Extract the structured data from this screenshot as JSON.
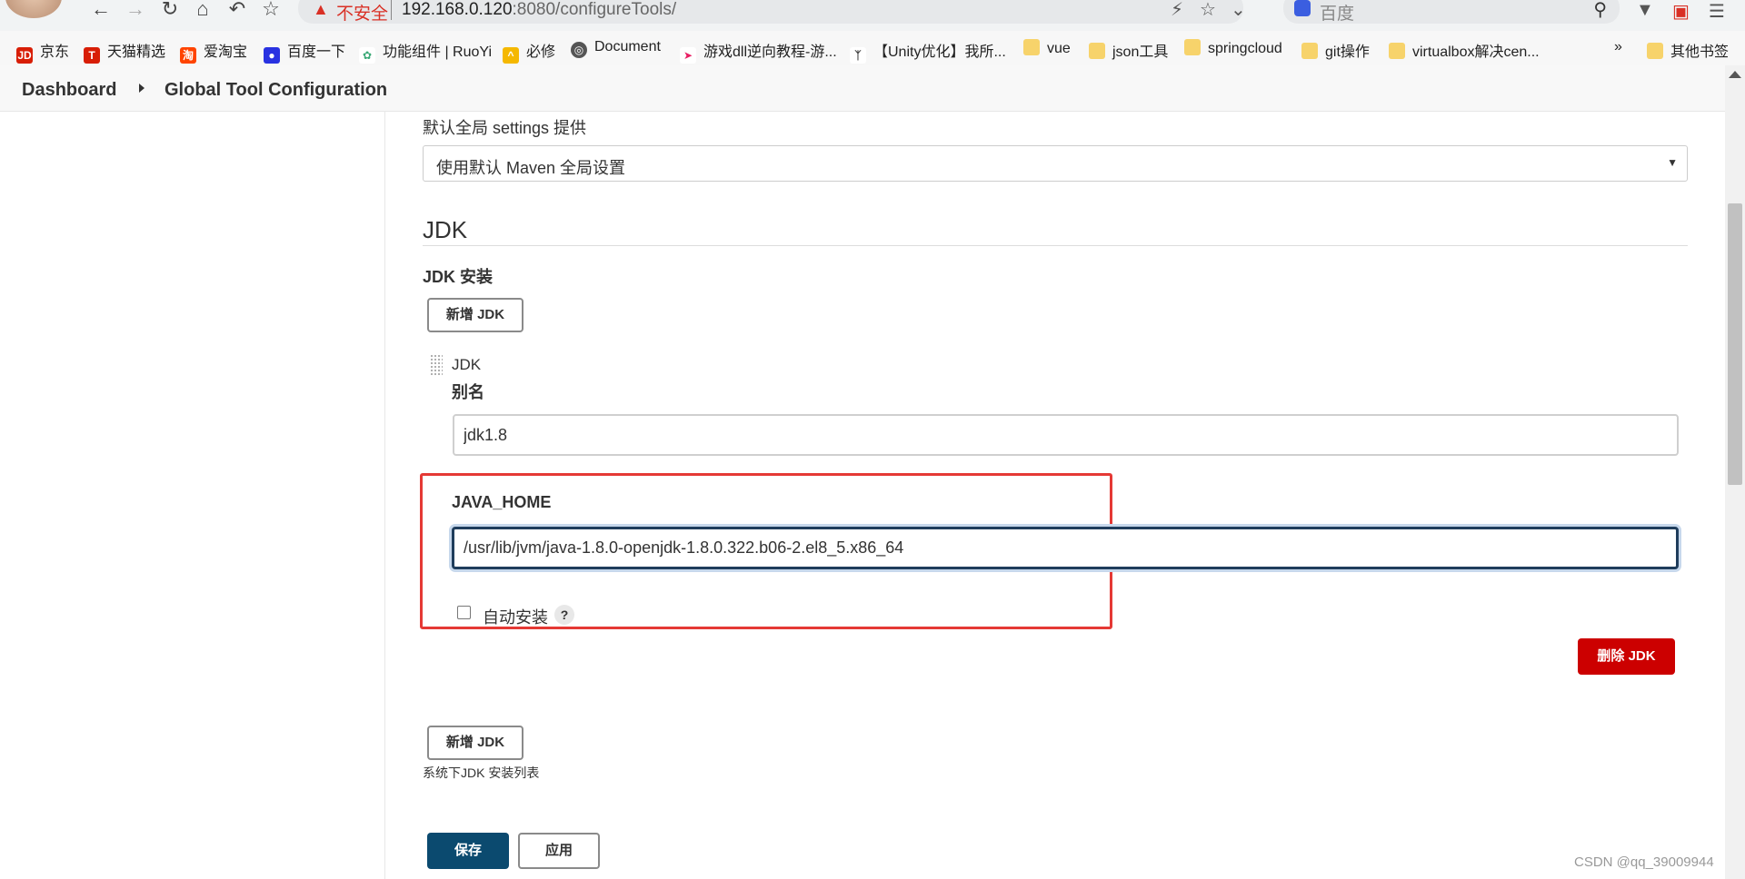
{
  "browser": {
    "security_warning": "不安全",
    "url_host": "192.168.0.120",
    "url_rest": ":8080/configureTools/",
    "search_placeholder": "百度"
  },
  "bookmarks": [
    {
      "label": "京东",
      "icon": "JD"
    },
    {
      "label": "天猫精选",
      "icon": "T"
    },
    {
      "label": "爱淘宝",
      "icon": "淘"
    },
    {
      "label": "百度一下",
      "icon": "baidu-paw-icon"
    },
    {
      "label": "功能组件 | RuoYi",
      "icon": "leaf-icon"
    },
    {
      "label": "必修",
      "icon": "bixiu-icon"
    },
    {
      "label": "Document",
      "icon": "globe-icon"
    },
    {
      "label": "游戏dll逆向教程-游...",
      "icon": "arrow-icon"
    },
    {
      "label": "【Unity优化】我所...",
      "icon": "unity-icon"
    },
    {
      "label": "vue",
      "icon": "folder-icon"
    },
    {
      "label": "json工具",
      "icon": "folder-icon"
    },
    {
      "label": "springcloud",
      "icon": "folder-icon"
    },
    {
      "label": "git操作",
      "icon": "folder-icon"
    },
    {
      "label": "virtualbox解决cen...",
      "icon": "folder-icon"
    }
  ],
  "bookmarks_more": "»",
  "bookmarks_other": "其他书签",
  "breadcrumb": {
    "home": "Dashboard",
    "current": "Global Tool Configuration"
  },
  "maven": {
    "global_settings_label": "默认全局 settings 提供",
    "global_settings_value": "使用默认 Maven 全局设置"
  },
  "jdk": {
    "section_title": "JDK",
    "install_label": "JDK 安装",
    "add_button": "新增 JDK",
    "item_header": "JDK",
    "alias_label": "别名",
    "alias_value": "jdk1.8",
    "java_home_label": "JAVA_HOME",
    "java_home_value": "/usr/lib/jvm/java-1.8.0-openjdk-1.8.0.322.b06-2.el8_5.x86_64",
    "auto_install_label": "自动安装",
    "auto_install_checked": false,
    "help_label": "?",
    "delete_button": "删除 JDK",
    "add_button_bottom": "新增 JDK",
    "list_hint": "系统下JDK 安装列表"
  },
  "actions": {
    "save": "保存",
    "apply": "应用"
  },
  "watermark": "CSDN @qq_39009944",
  "colors": {
    "danger": "#cc0000",
    "primary": "#0b4a6f",
    "highlight": "#e53935",
    "focus_border": "#1f3d5c"
  }
}
